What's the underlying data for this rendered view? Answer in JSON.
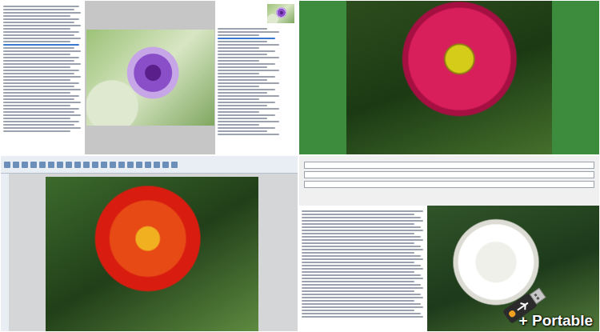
{
  "panes": [
    {
      "kind": "browser"
    },
    {
      "kind": "fullscreen"
    },
    {
      "kind": "editor"
    },
    {
      "kind": "batch"
    }
  ],
  "promo": {
    "label": "+ Portable"
  }
}
